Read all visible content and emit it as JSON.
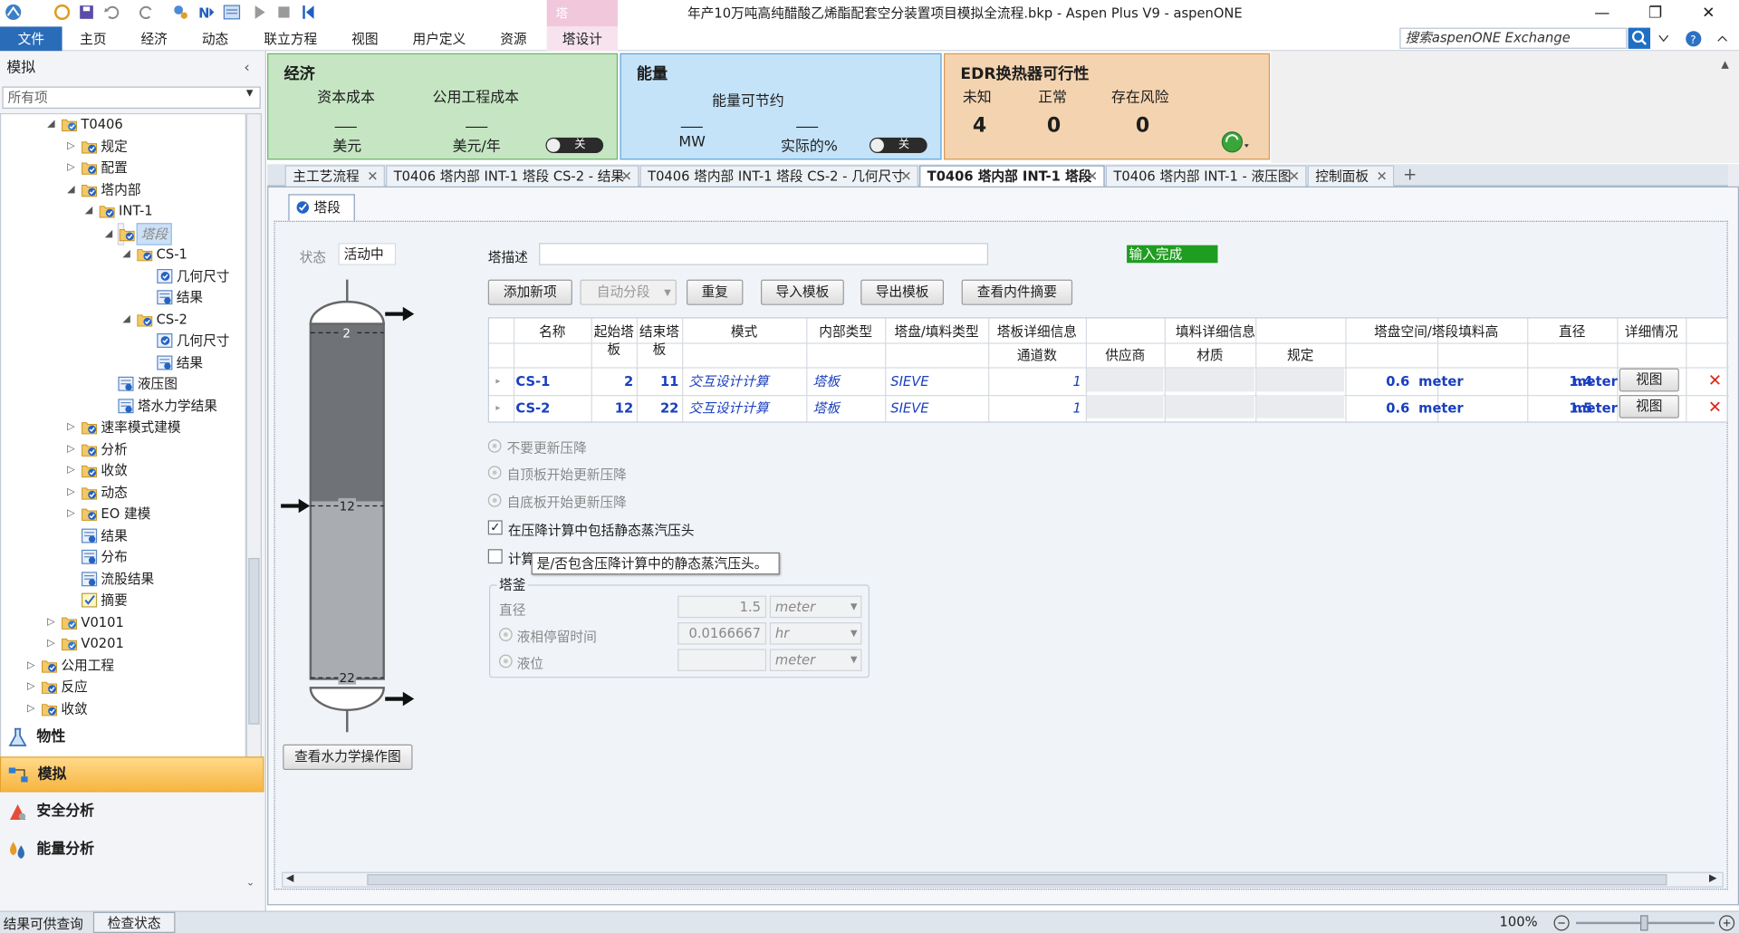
{
  "window": {
    "title": "年产10万吨高纯醋酸乙烯酯配套空分装置项目模拟全流程.bkp - Aspen Plus V9 - aspenONE",
    "context_tab": "塔",
    "minimize": "—",
    "maximize": "❐",
    "close": "✕"
  },
  "ribbon": {
    "tabs": [
      "文件",
      "主页",
      "经济",
      "动态",
      "联立方程",
      "视图",
      "用户定义",
      "资源",
      "塔设计"
    ],
    "search_placeholder": "搜索aspenONE Exchange"
  },
  "nav": {
    "header": "模拟",
    "filter": "所有项",
    "tree": [
      {
        "label": "T0406",
        "depth": 1,
        "expander": "◢",
        "icon": "block-folder-icon"
      },
      {
        "label": "规定",
        "depth": 2,
        "expander": "▷",
        "icon": "folder-check-icon"
      },
      {
        "label": "配置",
        "depth": 2,
        "expander": "▷",
        "icon": "folder-check-icon"
      },
      {
        "label": "塔内部",
        "depth": 2,
        "expander": "◢",
        "icon": "folder-check-icon"
      },
      {
        "label": "INT-1",
        "depth": 3,
        "expander": "◢",
        "icon": "folder-check-icon"
      },
      {
        "label": "塔段",
        "depth": 4,
        "expander": "◢",
        "icon": "folder-check-icon",
        "selected": true
      },
      {
        "label": "CS-1",
        "depth": 5,
        "expander": "◢",
        "icon": "folder-check-icon"
      },
      {
        "label": "几何尺寸",
        "depth": 6,
        "expander": "",
        "icon": "form-check-icon"
      },
      {
        "label": "结果",
        "depth": 6,
        "expander": "",
        "icon": "results-icon"
      },
      {
        "label": "CS-2",
        "depth": 5,
        "expander": "◢",
        "icon": "folder-check-icon"
      },
      {
        "label": "几何尺寸",
        "depth": 6,
        "expander": "",
        "icon": "form-check-icon"
      },
      {
        "label": "结果",
        "depth": 6,
        "expander": "",
        "icon": "results-icon"
      },
      {
        "label": "液压图",
        "depth": 4,
        "expander": "",
        "icon": "results-icon"
      },
      {
        "label": "塔水力学结果",
        "depth": 4,
        "expander": "",
        "icon": "results-icon"
      },
      {
        "label": "速率模式建模",
        "depth": 2,
        "expander": "▷",
        "icon": "folder-check-icon"
      },
      {
        "label": "分析",
        "depth": 2,
        "expander": "▷",
        "icon": "folder-check-icon"
      },
      {
        "label": "收敛",
        "depth": 2,
        "expander": "▷",
        "icon": "folder-check-icon"
      },
      {
        "label": "动态",
        "depth": 2,
        "expander": "▷",
        "icon": "folder-check-icon"
      },
      {
        "label": "EO 建模",
        "depth": 2,
        "expander": "▷",
        "icon": "folder-check-icon"
      },
      {
        "label": "结果",
        "depth": 2,
        "expander": "",
        "icon": "results-icon"
      },
      {
        "label": "分布",
        "depth": 2,
        "expander": "",
        "icon": "results-icon"
      },
      {
        "label": "流股结果",
        "depth": 2,
        "expander": "",
        "icon": "results-icon"
      },
      {
        "label": "摘要",
        "depth": 2,
        "expander": "",
        "icon": "summary-icon"
      },
      {
        "label": "V0101",
        "depth": 1,
        "expander": "▷",
        "icon": "block-folder-icon"
      },
      {
        "label": "V0201",
        "depth": 1,
        "expander": "▷",
        "icon": "block-folder-icon"
      },
      {
        "label": "公用工程",
        "depth": 0,
        "expander": "▷",
        "icon": "folder-check-icon"
      },
      {
        "label": "反应",
        "depth": 0,
        "expander": "▷",
        "icon": "folder-check-icon"
      },
      {
        "label": "收敛",
        "depth": 0,
        "expander": "▷",
        "icon": "folder-check-icon"
      }
    ],
    "panes": [
      {
        "label": "物性",
        "icon": "flask-icon"
      },
      {
        "label": "模拟",
        "icon": "flowsheet-icon",
        "selected": true
      },
      {
        "label": "安全分析",
        "icon": "safety-icon"
      },
      {
        "label": "能量分析",
        "icon": "energy-drops-icon"
      }
    ]
  },
  "dashboard": {
    "economics": {
      "title": "经济",
      "capital_label": "资本成本",
      "utility_label": "公用工程成本",
      "capital_value": "___",
      "utility_value": "___",
      "capital_unit": "美元",
      "utility_unit": "美元/年",
      "toggle": "关"
    },
    "energy": {
      "title": "能量",
      "savings_label": "能量可节约",
      "mw_value": "___",
      "pct_value": "___",
      "mw_unit": "MW",
      "pct_unit": "实际的%",
      "toggle": "关"
    },
    "edr": {
      "title": "EDR换热器可行性",
      "unknown_label": "未知",
      "normal_label": "正常",
      "risk_label": "存在风险",
      "unknown_value": "4",
      "normal_value": "0",
      "risk_value": "0"
    }
  },
  "doc_tabs": [
    {
      "label": "主工艺流程",
      "active": false
    },
    {
      "label": "T0406 塔内部 INT-1 塔段 CS-2 - 结果",
      "active": false
    },
    {
      "label": "T0406 塔内部 INT-1 塔段 CS-2 - 几何尺寸",
      "active": false
    },
    {
      "label": "T0406 塔内部 INT-1 塔段",
      "active": true
    },
    {
      "label": "T0406 塔内部 INT-1 - 液压图",
      "active": false
    },
    {
      "label": "控制面板",
      "active": false
    }
  ],
  "form": {
    "subtab": "塔段",
    "status_label": "状态",
    "status_value": "活动中",
    "desc_label": "塔描述",
    "desc_value": "",
    "input_status": "输入完成",
    "buttons": {
      "add": "添加新项",
      "auto": "自动分段",
      "repeat": "重复",
      "import": "导入模板",
      "export": "导出模板",
      "summary": "查看内件摘要",
      "hydraulic": "查看水力学操作图"
    },
    "column_diagram": {
      "top_stage": "2",
      "feed_stage": "12",
      "bottom_stage": "22"
    },
    "grid": {
      "headers": {
        "name": "名称",
        "start": "起始塔板",
        "end": "结束塔板",
        "mode": "模式",
        "internal_type": "内部类型",
        "tray_type": "塔盘/填料类型",
        "tray_detail": "塔板详细信息",
        "passes": "通道数",
        "packing_detail": "填料详细信息",
        "vendor": "供应商",
        "material": "材质",
        "spec": "规定",
        "spacing": "塔盘空间/塔段填料高",
        "diameter": "直径",
        "details": "详细情况"
      },
      "rows": [
        {
          "name": "CS-1",
          "start": "2",
          "end": "11",
          "mode": "交互设计计算",
          "internal_type": "塔板",
          "tray_type": "SIEVE",
          "passes": "1",
          "spacing": "0.6",
          "spacing_unit": "meter",
          "diameter": "1.4",
          "diameter_unit": "meter",
          "view": "视图"
        },
        {
          "name": "CS-2",
          "start": "12",
          "end": "22",
          "mode": "交互设计计算",
          "internal_type": "塔板",
          "tray_type": "SIEVE",
          "passes": "1",
          "spacing": "0.6",
          "spacing_unit": "meter",
          "diameter": "1.5",
          "diameter_unit": "meter",
          "view": "视图"
        }
      ]
    },
    "options": {
      "no_update": "不要更新压降",
      "from_top": "自顶板开始更新压降",
      "from_bottom": "自底板开始更新压降",
      "include_static": "在压降计算中包括静态蒸汽压头",
      "calc_prefix": "计算",
      "tooltip": "是/否包含压降计算中的静态蒸汽压头。"
    },
    "reboiler": {
      "group_label": "塔釜",
      "diameter_label": "直径",
      "diameter_value": "1.5",
      "diameter_unit": "meter",
      "holdup_label": "液相停留时间",
      "holdup_value": "0.0166667",
      "holdup_unit": "hr",
      "level_label": "液位",
      "level_value": "",
      "level_unit": "meter"
    }
  },
  "status_bar": {
    "results_label": "结果可供查询",
    "check_button": "检查状态",
    "zoom": "100%"
  }
}
